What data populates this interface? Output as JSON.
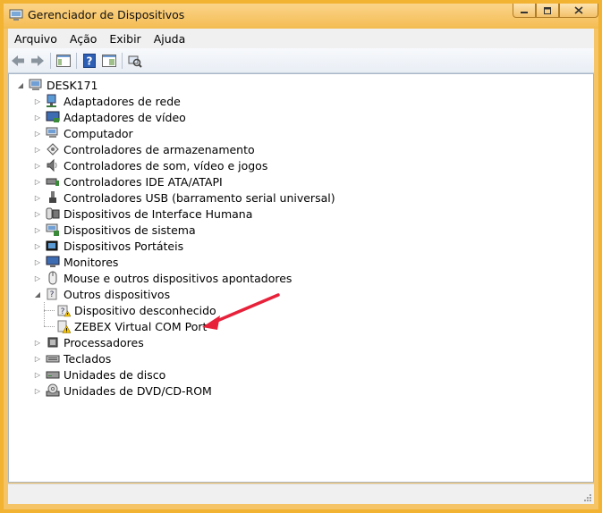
{
  "window": {
    "title": "Gerenciador de Dispositivos"
  },
  "menu": [
    "Arquivo",
    "Ação",
    "Exibir",
    "Ajuda"
  ],
  "tree": {
    "root": "DESK171",
    "items": [
      "Adaptadores de rede",
      "Adaptadores de vídeo",
      "Computador",
      "Controladores de armazenamento",
      "Controladores de som, vídeo e jogos",
      "Controladores IDE ATA/ATAPI",
      "Controladores USB (barramento serial universal)",
      "Dispositivos de Interface Humana",
      "Dispositivos de sistema",
      "Dispositivos Portáteis",
      "Monitores",
      "Mouse e outros dispositivos apontadores",
      "Outros dispositivos",
      "Processadores",
      "Teclados",
      "Unidades de disco",
      "Unidades de DVD/CD-ROM"
    ],
    "other_children": [
      "Dispositivo desconhecido",
      "ZEBEX Virtual COM Port"
    ]
  },
  "colors": {
    "accent": "#f2b232",
    "arrow": "#e8213a",
    "warning": "#f5c400"
  }
}
